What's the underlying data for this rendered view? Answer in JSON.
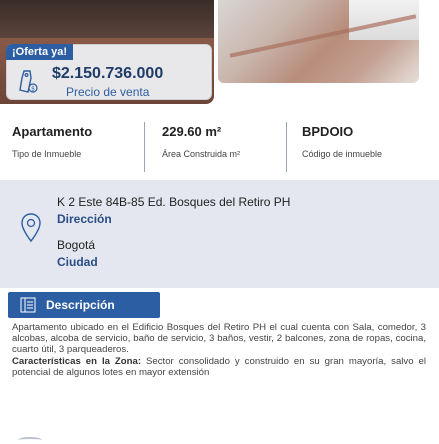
{
  "offer": {
    "badge": "¡Oferta ya!",
    "price": "$2.150.736.000",
    "price_label": "Precio de venta",
    "icon": "price-tag-icon"
  },
  "details": [
    {
      "value": "Apartamento",
      "label": "Tipo de Inmueble"
    },
    {
      "value": "229.60 m²",
      "label": "Área Construida m²"
    },
    {
      "value": "BPDOIO",
      "label": "Código de inmueble"
    }
  ],
  "address": {
    "value": "K 2 Este 84B-85 Ed. Bosques del Retiro PH",
    "label": "Dirección",
    "icon": "location-pin-icon"
  },
  "city": {
    "value": "Bogotá",
    "label": "Ciudad"
  },
  "description": {
    "tab_label": "Descripción",
    "tab_icon": "list-lines-icon",
    "paragraph1": "Apartamento ubicado en el Edificio Bosques del Retiro PH el cual cuenta con Sala, comedor, 3 alcobas, alcoba de servicio, baño de servicio, 3 baños, vestir, 2 balcones, zona de ropas, cocina, cuarto útil, 3 parqueaderos.",
    "zone_title": "Características en la Zona:",
    "paragraph2": " Sector consolidado y construido en su gran mayoría, salvo el potencial de algunos lotes en mayor extensión"
  },
  "colors": {
    "brand_blue": "#2c5ea3",
    "dark_blue": "#1f3c68",
    "address_bg": "#e4e7ef"
  }
}
